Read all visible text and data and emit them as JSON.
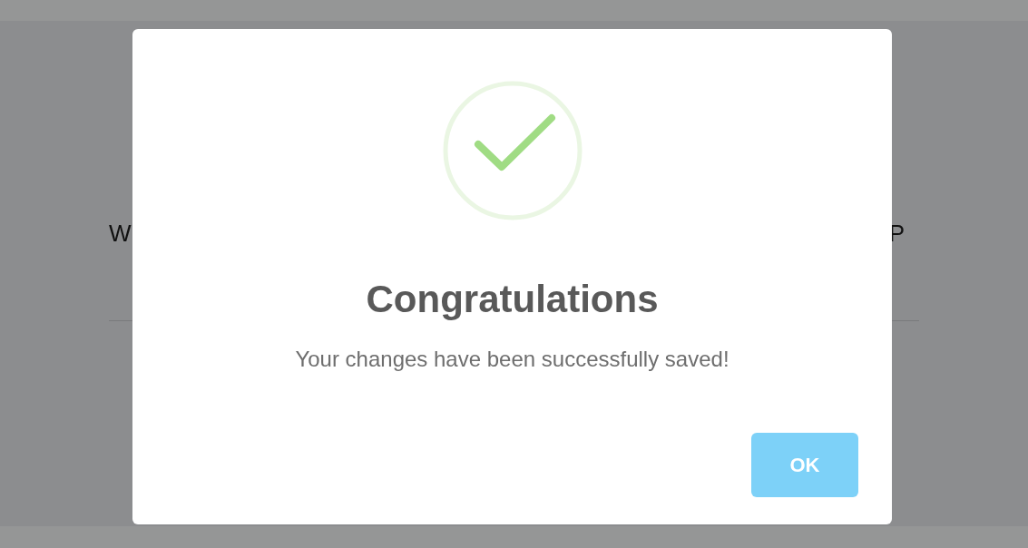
{
  "background_page": {
    "heading_start": "W",
    "heading_end": "P"
  },
  "dialog": {
    "title": "Congratulations",
    "message": "Your changes have been successfully saved!",
    "buttons": [
      {
        "label": "OK"
      }
    ]
  }
}
